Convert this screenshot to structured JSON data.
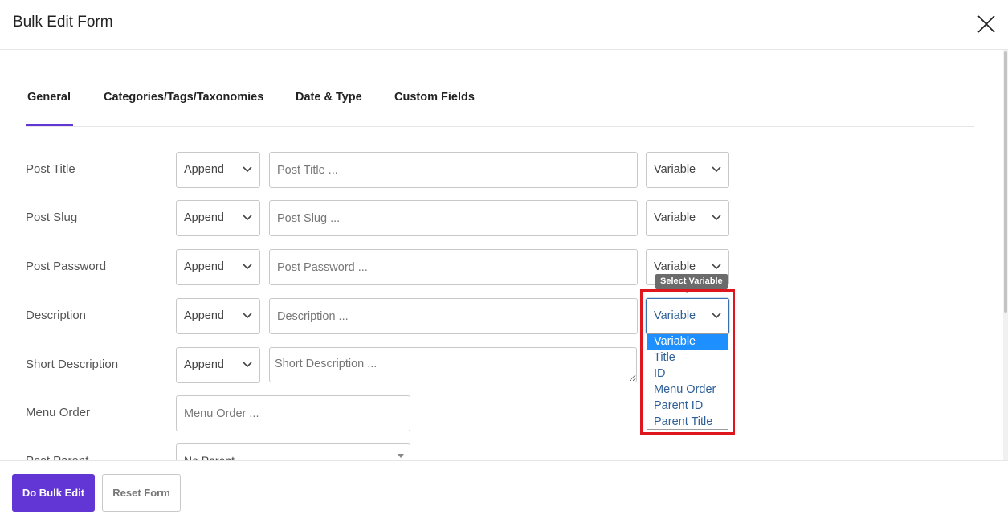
{
  "modal": {
    "title": "Bulk Edit Form",
    "close_icon": "close-icon"
  },
  "tabs": [
    {
      "label": "General",
      "active": true
    },
    {
      "label": "Categories/Tags/Taxonomies",
      "active": false
    },
    {
      "label": "Date & Type",
      "active": false
    },
    {
      "label": "Custom Fields",
      "active": false
    }
  ],
  "fields": {
    "post_title": {
      "label": "Post Title",
      "mode": "Append",
      "placeholder": "Post Title ...",
      "variable": "Variable"
    },
    "post_slug": {
      "label": "Post Slug",
      "mode": "Append",
      "placeholder": "Post Slug ...",
      "variable": "Variable"
    },
    "post_password": {
      "label": "Post Password",
      "mode": "Append",
      "placeholder": "Post Password ...",
      "variable": "Variable"
    },
    "description": {
      "label": "Description",
      "mode": "Append",
      "placeholder": "Description ...",
      "variable": "Variable"
    },
    "short_description": {
      "label": "Short Description",
      "mode": "Append",
      "placeholder": "Short Description ..."
    },
    "menu_order": {
      "label": "Menu Order",
      "placeholder": "Menu Order ..."
    },
    "post_parent": {
      "label": "Post Parent",
      "value": "No Parent"
    }
  },
  "tooltip": "Select Variable",
  "variable_dropdown": {
    "options": [
      "Variable",
      "Title",
      "ID",
      "Menu Order",
      "Parent ID",
      "Parent Title"
    ],
    "selected": "Variable"
  },
  "footer": {
    "primary_label": "Do Bulk Edit",
    "secondary_label": "Reset Form"
  },
  "colors": {
    "accent": "#6236d5",
    "highlight": "#e0161e",
    "option_selected": "#1e8fff",
    "option_text": "#2e5f98"
  }
}
